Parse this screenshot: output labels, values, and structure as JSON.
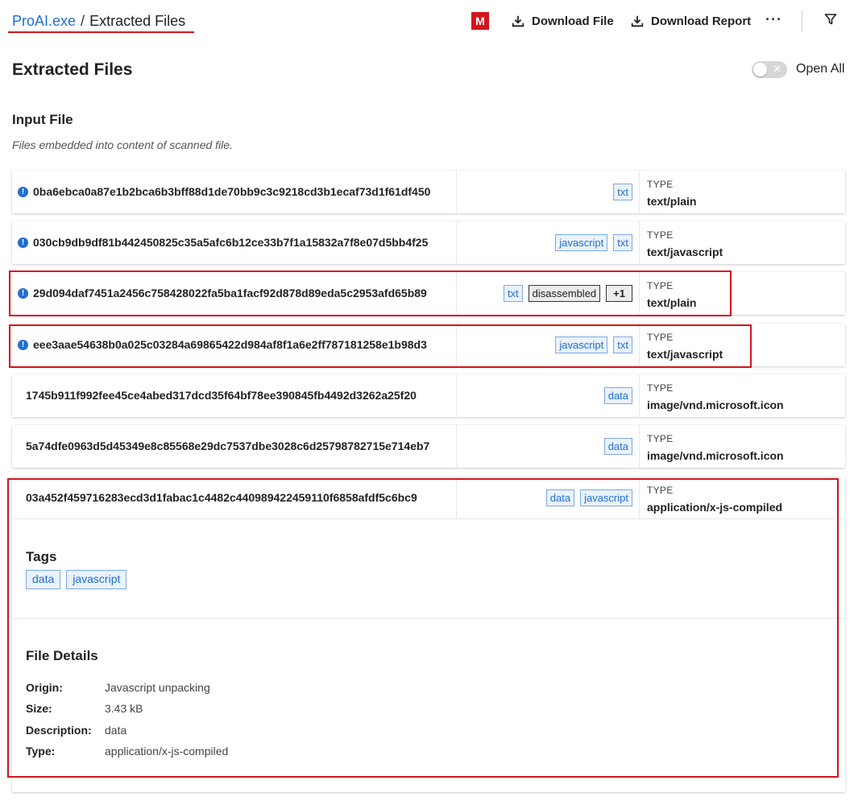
{
  "breadcrumb": {
    "link": "ProAI.exe",
    "separator": "/",
    "current": "Extracted Files"
  },
  "header": {
    "badge": "M",
    "download_file": "Download File",
    "download_report": "Download Report",
    "more": "···",
    "accent": "#d4141c"
  },
  "page": {
    "title": "Extracted Files",
    "open_all": "Open All",
    "open_all_on": false
  },
  "section": {
    "title": "Input File",
    "subtitle": "Files embedded into content of scanned file."
  },
  "type_label": "TYPE",
  "rows": [
    {
      "hash": "0ba6ebca0a87e1b2bca6b3bff88d1de70bb9c3c9218cd3b1ecaf73d1f61df450",
      "tags": [
        "txt"
      ],
      "type": "text/plain",
      "info": true
    },
    {
      "hash": "030cb9db9df81b442450825c35a5afc6b12ce33b7f1a15832a7f8e07d5bb4f25",
      "tags": [
        "javascript",
        "txt"
      ],
      "type": "text/javascript",
      "info": true
    },
    {
      "hash": "29d094daf7451a2456c758428022fa5ba1facf92d878d89eda5c2953afd65b89",
      "tags": [
        "txt",
        "disassembled",
        "+1"
      ],
      "type": "text/plain",
      "info": true
    },
    {
      "hash": "eee3aae54638b0a025c03284a69865422d984af8f1a6e2ff787181258e1b98d3",
      "tags": [
        "javascript",
        "txt"
      ],
      "type": "text/javascript",
      "info": true
    },
    {
      "hash": "1745b911f992fee45ce4abed317dcd35f64bf78ee390845fb4492d3262a25f20",
      "tags": [
        "data"
      ],
      "type": "image/vnd.microsoft.icon",
      "info": false
    },
    {
      "hash": "5a74dfe0963d5d45349e8c85568e29dc7537dbe3028c6d25798782715e714eb7",
      "tags": [
        "data"
      ],
      "type": "image/vnd.microsoft.icon",
      "info": false
    }
  ],
  "expanded": {
    "hash": "03a452f459716283ecd3d1fabac1c4482c440989422459110f6858afdf5c6bc9",
    "tags": [
      "data",
      "javascript"
    ],
    "type": "application/x-js-compiled",
    "tags_title": "Tags",
    "details_title": "File Details",
    "details": [
      {
        "key": "Origin:",
        "value": "Javascript unpacking"
      },
      {
        "key": "Size:",
        "value": "3.43 kB"
      },
      {
        "key": "Description:",
        "value": "data"
      },
      {
        "key": "Type:",
        "value": "application/x-js-compiled"
      }
    ]
  }
}
